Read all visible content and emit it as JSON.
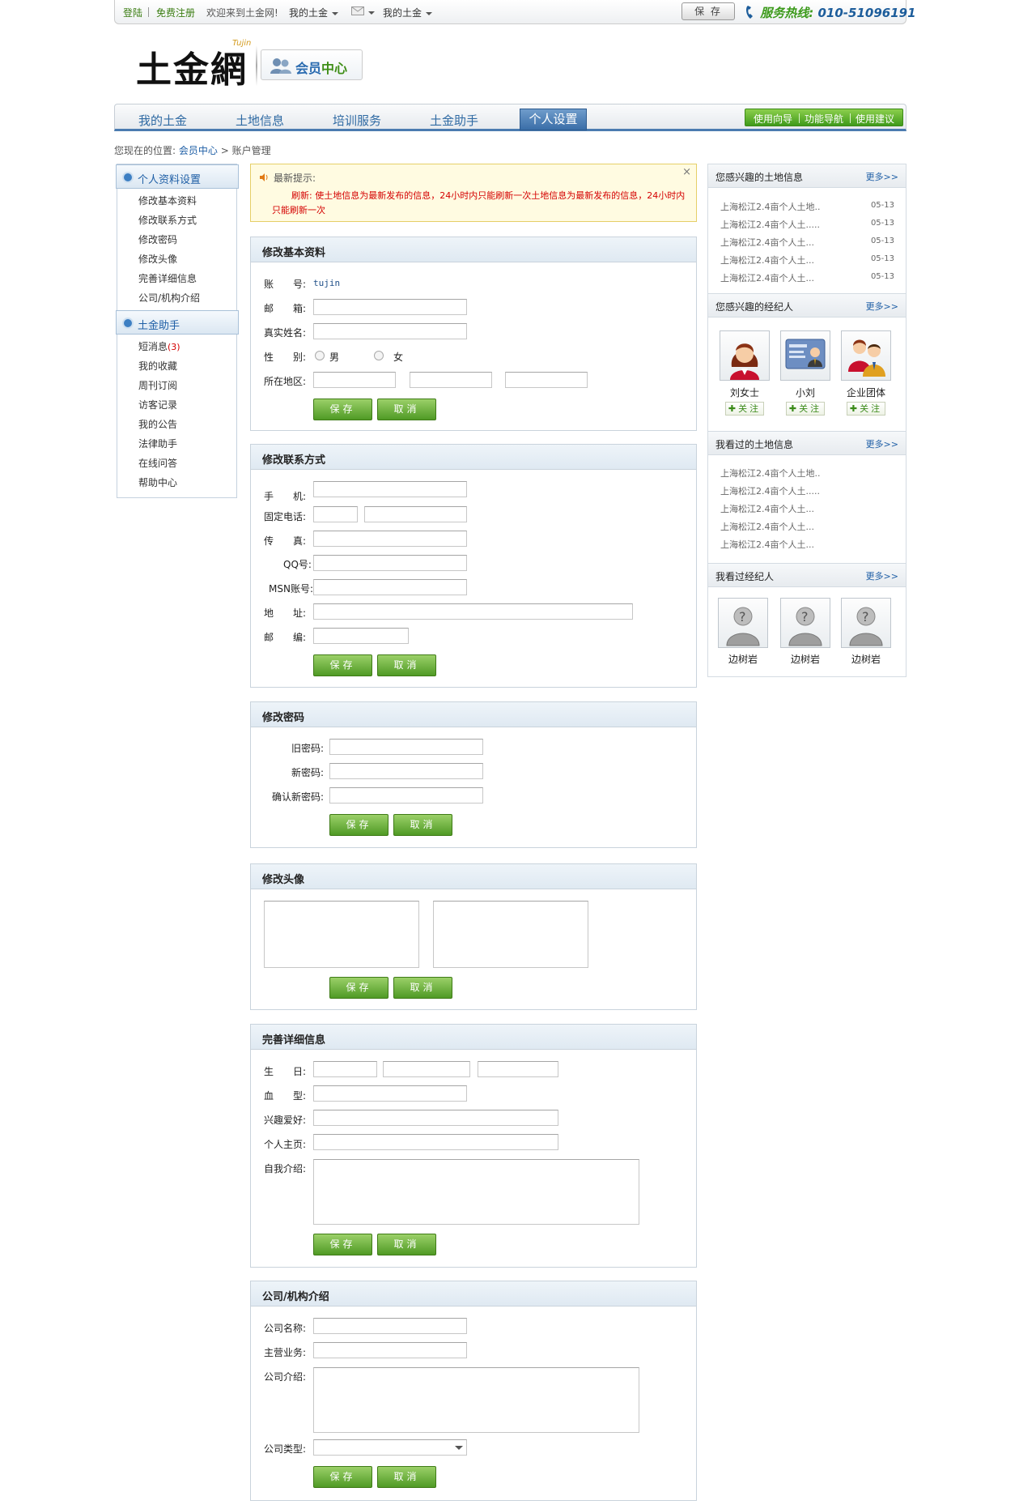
{
  "topbar": {
    "login": "登陆",
    "register": "免费注册",
    "welcome": "欢迎来到土金网!",
    "my_tujin": "我的土金",
    "my_tujin2": "我的土金",
    "save": "保 存",
    "hotline_label": "服务热线:",
    "hotline_number": "010-51096191"
  },
  "logo": {
    "text": "土金網",
    "sub": "Tujin",
    "member_center_a": "会员",
    "member_center_b": "中心"
  },
  "nav": {
    "items": [
      "我的土金",
      "土地信息",
      "培训服务",
      "土金助手",
      "个人设置"
    ],
    "links": [
      "使用向导",
      "功能导航",
      "使用建议"
    ]
  },
  "breadcrumb": {
    "prefix": "您现在的位置:",
    "home": "会员中心",
    "sep": ">",
    "current": "账户管理"
  },
  "sidebar": {
    "group1_title": "个人资料设置",
    "group1": [
      "修改基本资料",
      "修改联系方式",
      "修改密码",
      "修改头像",
      "完善详细信息",
      "公司/机构介绍"
    ],
    "group2_title": "土金助手",
    "group2": [
      "短消息",
      "我的收藏",
      "周刊订阅",
      "访客记录",
      "我的公告",
      "法律助手",
      "在线问答",
      "帮助中心"
    ],
    "sms_count": "(3)"
  },
  "notice": {
    "title": "最新提示:",
    "text": "刷新: 使土地信息为最新发布的信息，24小时内只能刷新一次土地信息为最新发布的信息，24小时内只能刷新一次",
    "close": "×"
  },
  "buttons": {
    "save": "保存",
    "cancel": "取消"
  },
  "basic": {
    "title": "修改基本资料",
    "account_label": "账　　号:",
    "account_value": "tujin",
    "email_label": "邮　　箱:",
    "realname_label": "真实姓名:",
    "gender_label": "性　　别:",
    "male": "男",
    "female": "女",
    "region_label": "所在地区:"
  },
  "contact": {
    "title": "修改联系方式",
    "mobile": "手　　机:",
    "phone": "固定电话:",
    "fax": "传　　真:",
    "qq": "QQ号:",
    "msn": "MSN账号:",
    "address": "地　　址:",
    "zip": "邮　　编:"
  },
  "password": {
    "title": "修改密码",
    "old": "旧密码:",
    "new": "新密码:",
    "confirm": "确认新密码:"
  },
  "avatar": {
    "title": "修改头像"
  },
  "detail": {
    "title": "完善详细信息",
    "birthday": "生　　日:",
    "blood": "血　　型:",
    "hobby": "兴趣爱好:",
    "homepage": "个人主页:",
    "intro": "自我介绍:"
  },
  "company": {
    "title": "公司/机构介绍",
    "name": "公司名称:",
    "business": "主营业务:",
    "intro": "公司介绍:",
    "type": "公司类型:"
  },
  "right": {
    "more": "更多>>",
    "land_title": "您感兴趣的土地信息",
    "land_items": [
      {
        "text": "上海松江2.4亩个人土地..",
        "date": "05-13"
      },
      {
        "text": "上海松江2.4亩个人土.....",
        "date": "05-13"
      },
      {
        "text": "上海松江2.4亩个人土...",
        "date": "05-13"
      },
      {
        "text": "上海松江2.4亩个人土...",
        "date": "05-13"
      },
      {
        "text": "上海松江2.4亩个人土...",
        "date": "05-13"
      }
    ],
    "agent_title": "您感兴趣的经纪人",
    "agents": [
      "刘女士",
      "小刘",
      "企业团体"
    ],
    "follow": "关注",
    "viewed_land_title": "我看过的土地信息",
    "viewed_land": [
      "上海松江2.4亩个人土地..",
      "上海松江2.4亩个人土.....",
      "上海松江2.4亩个人土...",
      "上海松江2.4亩个人土...",
      "上海松江2.4亩个人土..."
    ],
    "viewed_agent_title": "我看过经纪人",
    "viewed_agents": [
      "边树岩",
      "边树岩",
      "边树岩"
    ]
  }
}
